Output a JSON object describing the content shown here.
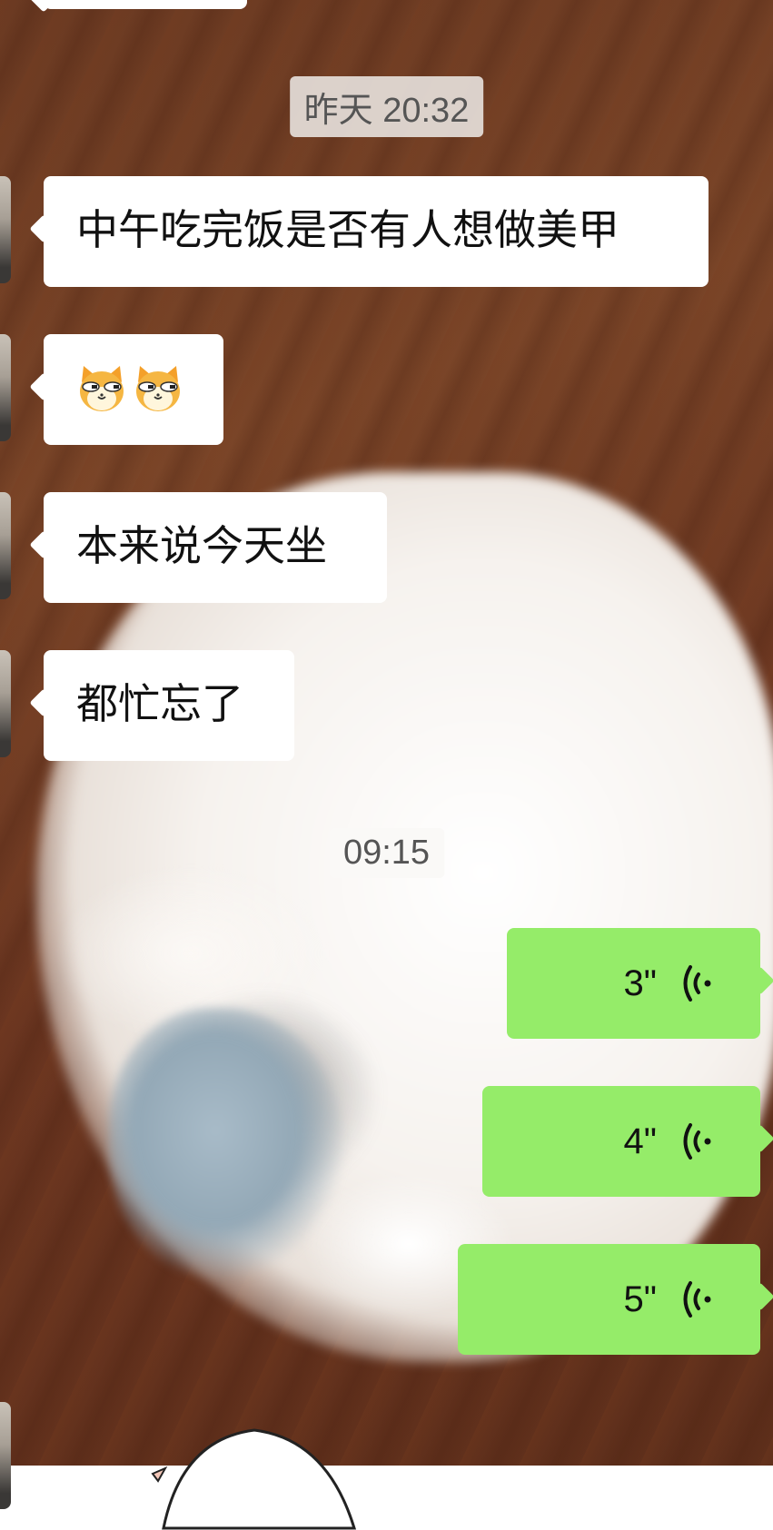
{
  "timestamps": [
    "昨天 20:32",
    "09:15"
  ],
  "incoming": [
    {
      "type": "text",
      "text": "中午吃完饭是否有人想做美甲"
    },
    {
      "type": "emoji",
      "emoji_icon": "doge-cat-emoji",
      "count": 2
    },
    {
      "type": "text",
      "text": "本来说今天坐"
    },
    {
      "type": "text",
      "text": "都忙忘了"
    }
  ],
  "outgoing_voice": [
    {
      "duration": "3\""
    },
    {
      "duration": "4\""
    },
    {
      "duration": "5\""
    }
  ],
  "colors": {
    "bubble_in": "#ffffff",
    "bubble_out": "#95ec69",
    "timestamp_bg": "#e8e2de"
  }
}
